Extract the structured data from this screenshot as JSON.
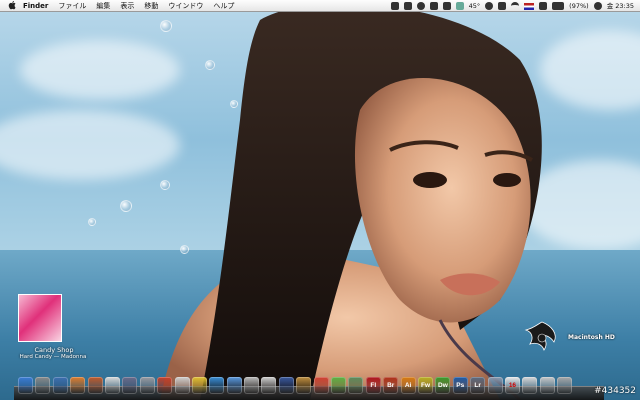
{
  "menubar": {
    "apple_icon": "apple-icon",
    "app_name": "Finder",
    "items": [
      "ファイル",
      "編集",
      "表示",
      "移動",
      "ウインドウ",
      "ヘルプ"
    ],
    "status": {
      "temperature": "45°",
      "battery": "(97%)",
      "clock": "金 23:35"
    }
  },
  "desktop": {
    "album_widget": {
      "song": "Candy Shop",
      "artist_line": "Hard Candy — Madonna"
    },
    "hd_label": {
      "name": "Macintosh HD"
    }
  },
  "dock": {
    "items": [
      {
        "name": "finder-icon",
        "label": "",
        "color": "#3a7bd5"
      },
      {
        "name": "system-preferences-icon",
        "label": "",
        "color": "#8a8a8a"
      },
      {
        "name": "utilities-icon",
        "label": "",
        "color": "#3d6fb0"
      },
      {
        "name": "automator-icon",
        "label": "",
        "color": "#e07b2a"
      },
      {
        "name": "photo-icon",
        "label": "",
        "color": "#c25a2a"
      },
      {
        "name": "text-editor-icon",
        "label": "",
        "color": "#d9d9d9"
      },
      {
        "name": "pen-tool-icon",
        "label": "",
        "color": "#6a6a8a"
      },
      {
        "name": "script-icon",
        "label": "",
        "color": "#9a9aa0"
      },
      {
        "name": "firewall-icon",
        "label": "",
        "color": "#c8402a"
      },
      {
        "name": "scanner-icon",
        "label": "",
        "color": "#cfcfcf"
      },
      {
        "name": "chrome-icon",
        "label": "",
        "color": "#e0c030"
      },
      {
        "name": "safari-icon",
        "label": "",
        "color": "#3a90d8"
      },
      {
        "name": "itunes-icon",
        "label": "",
        "color": "#5a9ae0"
      },
      {
        "name": "ipod-icon",
        "label": "",
        "color": "#bcbcbc"
      },
      {
        "name": "scissors-icon",
        "label": "",
        "color": "#d0d0d0"
      },
      {
        "name": "pen-icon",
        "label": "",
        "color": "#3a5aa0"
      },
      {
        "name": "script-editor-icon",
        "label": "",
        "color": "#c09040"
      },
      {
        "name": "finder-shortcut-icon",
        "label": "",
        "color": "#d04030"
      },
      {
        "name": "leaf-icon",
        "label": "",
        "color": "#5ab040"
      },
      {
        "name": "activity-icon",
        "label": "",
        "color": "#5a8a5a"
      },
      {
        "name": "flash-icon",
        "label": "Fl",
        "color": "#b0121a"
      },
      {
        "name": "bridge-icon",
        "label": "Br",
        "color": "#b03018"
      },
      {
        "name": "illustrator-icon",
        "label": "Ai",
        "color": "#d87a10"
      },
      {
        "name": "fireworks-icon",
        "label": "Fw",
        "color": "#b8b020"
      },
      {
        "name": "dreamweaver-icon",
        "label": "Dw",
        "color": "#3a9a2a"
      },
      {
        "name": "photoshop-icon",
        "label": "Ps",
        "color": "#1a5aa8"
      },
      {
        "name": "lightroom-icon",
        "label": "Lr",
        "color": "#5a6a80"
      },
      {
        "name": "chat-icon",
        "label": "",
        "color": "#8a9ab0"
      },
      {
        "name": "calendar-icon",
        "label": "16",
        "color": "#e8e8e8"
      },
      {
        "name": "clock-icon",
        "label": "",
        "color": "#d8d8d8"
      },
      {
        "name": "network-icon",
        "label": "",
        "color": "#c8c8c8"
      },
      {
        "name": "trash-icon",
        "label": "",
        "color": "#a8a8a8"
      }
    ]
  },
  "watermark": "#434352"
}
